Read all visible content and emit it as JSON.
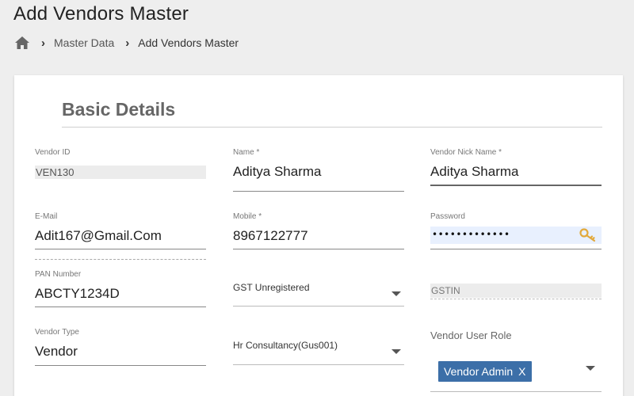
{
  "header": {
    "title": "Add Vendors Master"
  },
  "breadcrumb": {
    "items": [
      "Master Data",
      "Add Vendors Master"
    ]
  },
  "section": {
    "title": "Basic Details"
  },
  "fields": {
    "vendor_id": {
      "label": "Vendor ID",
      "value": "VEN130"
    },
    "name": {
      "label": "Name *",
      "value": "Aditya Sharma"
    },
    "nick_name": {
      "label": "Vendor Nick Name *",
      "value": "Aditya Sharma"
    },
    "email": {
      "label": "E-Mail",
      "value": "Adit167@Gmail.Com"
    },
    "mobile": {
      "label": "Mobile *",
      "value": "8967122777"
    },
    "password": {
      "label": "Password",
      "value": "•••••••••••••"
    },
    "pan": {
      "label": "PAN Number",
      "value": "ABCTY1234D"
    },
    "gst_status": {
      "value": "GST Unregistered"
    },
    "gstin": {
      "placeholder": "GSTIN"
    },
    "vendor_type": {
      "label": "Vendor Type",
      "value": "Vendor"
    },
    "category": {
      "value": "Hr Consultancy(Gus001)"
    },
    "user_role": {
      "label": "Vendor User Role",
      "chip": "Vendor Admin",
      "chip_remove": "X"
    }
  },
  "colors": {
    "chip_bg": "#3c6fa8",
    "autofill_bg": "#e8f0fe",
    "key_icon": "#e2a93b"
  }
}
